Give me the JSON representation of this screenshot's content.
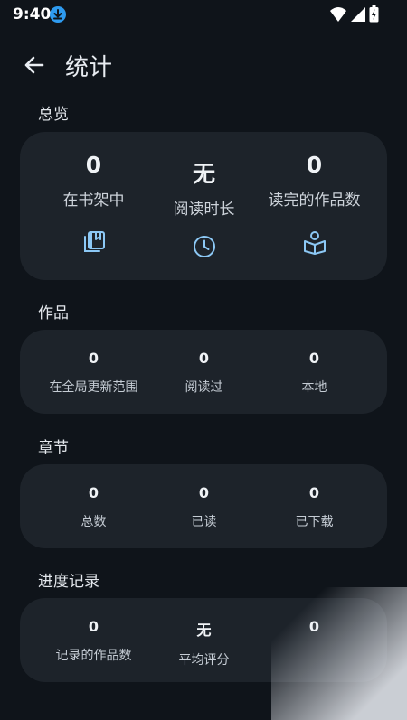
{
  "status": {
    "time": "9:40"
  },
  "header": {
    "title": "统计"
  },
  "overview": {
    "title": "总览",
    "items": [
      {
        "value": "0",
        "label": "在书架中",
        "icon": "bookshelf-icon"
      },
      {
        "value": "无",
        "label": "阅读时长",
        "icon": "clock-icon"
      },
      {
        "value": "0",
        "label": "读完的作品数",
        "icon": "book-read-icon"
      }
    ]
  },
  "works": {
    "title": "作品",
    "items": [
      {
        "value": "0",
        "label": "在全局更新范围"
      },
      {
        "value": "0",
        "label": "阅读过"
      },
      {
        "value": "0",
        "label": "本地"
      }
    ]
  },
  "chapters": {
    "title": "章节",
    "items": [
      {
        "value": "0",
        "label": "总数"
      },
      {
        "value": "0",
        "label": "已读"
      },
      {
        "value": "0",
        "label": "已下载"
      }
    ]
  },
  "progress": {
    "title": "进度记录",
    "items": [
      {
        "value": "0",
        "label": "记录的作品数"
      },
      {
        "value": "无",
        "label": "平均评分"
      },
      {
        "value": "0",
        "label": ""
      }
    ]
  },
  "colors": {
    "accent": "#8cc8f5",
    "background": "#0f141a",
    "card": "#1d232a"
  }
}
